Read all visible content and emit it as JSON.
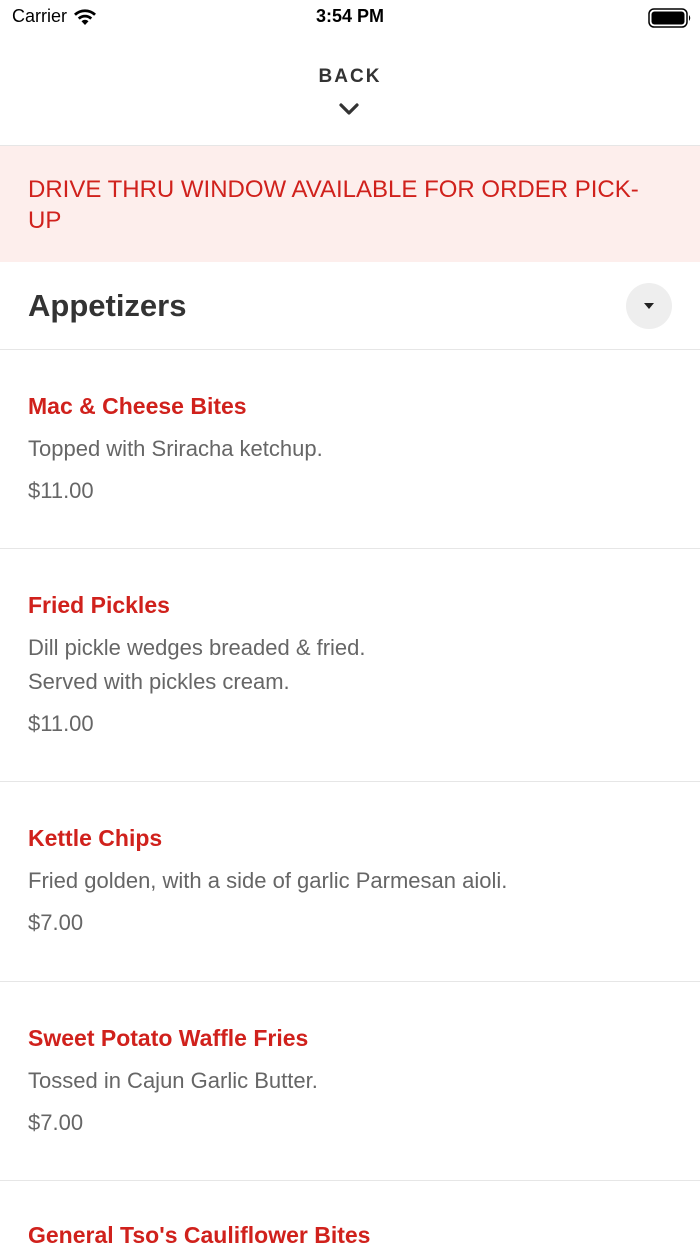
{
  "status_bar": {
    "carrier": "Carrier",
    "time": "3:54 PM"
  },
  "header": {
    "back_label": "BACK",
    "chevron_icon": "chevron-down-icon"
  },
  "banner": {
    "text": "DRIVE THRU WINDOW AVAILABLE FOR ORDER PICK-UP",
    "color": "#d0211c",
    "background": "#fdeeec"
  },
  "section": {
    "title": "Appetizers",
    "toggle_icon": "caret-down-icon"
  },
  "menu_items": [
    {
      "name": "Mac & Cheese Bites",
      "description": "Topped with Sriracha ketchup.",
      "price": "$11.00"
    },
    {
      "name": "Fried Pickles",
      "description": "Dill pickle wedges breaded & fried.\nServed with pickles cream.",
      "price": "$11.00"
    },
    {
      "name": "Kettle Chips",
      "description": "Fried golden, with a side of garlic Parmesan aioli.",
      "price": "$7.00"
    },
    {
      "name": "Sweet Potato Waffle Fries",
      "description": "Tossed in Cajun Garlic Butter.",
      "price": "$7.00"
    },
    {
      "name": "General Tso's Cauliflower Bites"
    }
  ],
  "colors": {
    "accent": "#d0211c",
    "text_primary": "#333333",
    "text_secondary": "#666666",
    "divider": "#e6e6e6"
  }
}
